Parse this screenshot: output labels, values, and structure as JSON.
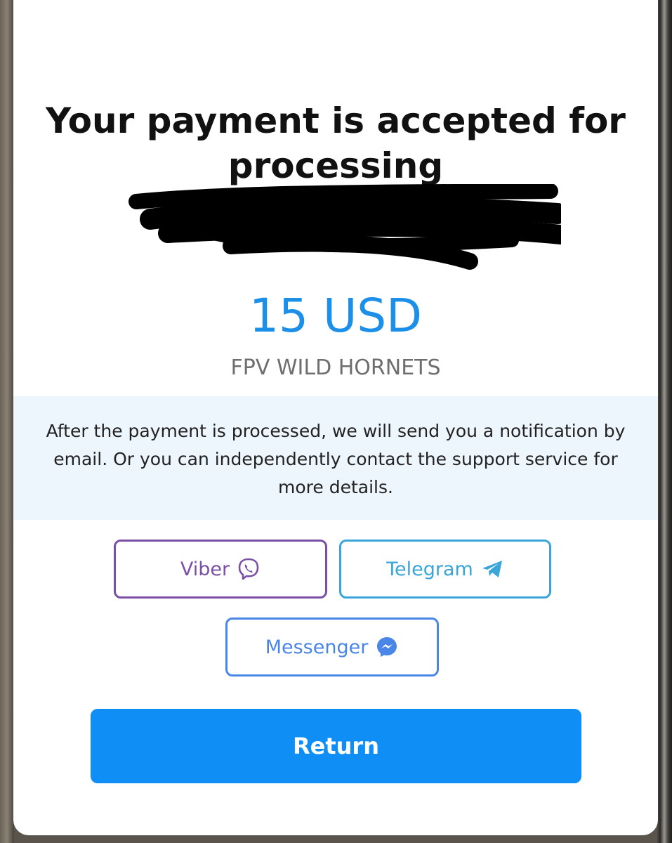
{
  "dialog": {
    "title": "Your payment is accepted for processing",
    "amount": "15 USD",
    "merchant": "FPV WILD HORNETS",
    "notice": "After the payment is processed, we will send you a notification by email. Or you can independently contact the support service for more details."
  },
  "contacts": {
    "viber": {
      "label": "Viber",
      "icon": "viber-icon",
      "color": "#7a4fa6"
    },
    "telegram": {
      "label": "Telegram",
      "icon": "telegram-icon",
      "color": "#3aa5d8"
    },
    "messenger": {
      "label": "Messenger",
      "icon": "messenger-icon",
      "color": "#4a86e8"
    }
  },
  "actions": {
    "return_label": "Return",
    "color": "#0f8ff5"
  },
  "colors": {
    "amount": "#1c8fe8",
    "notice_background": "#eef6fd"
  }
}
